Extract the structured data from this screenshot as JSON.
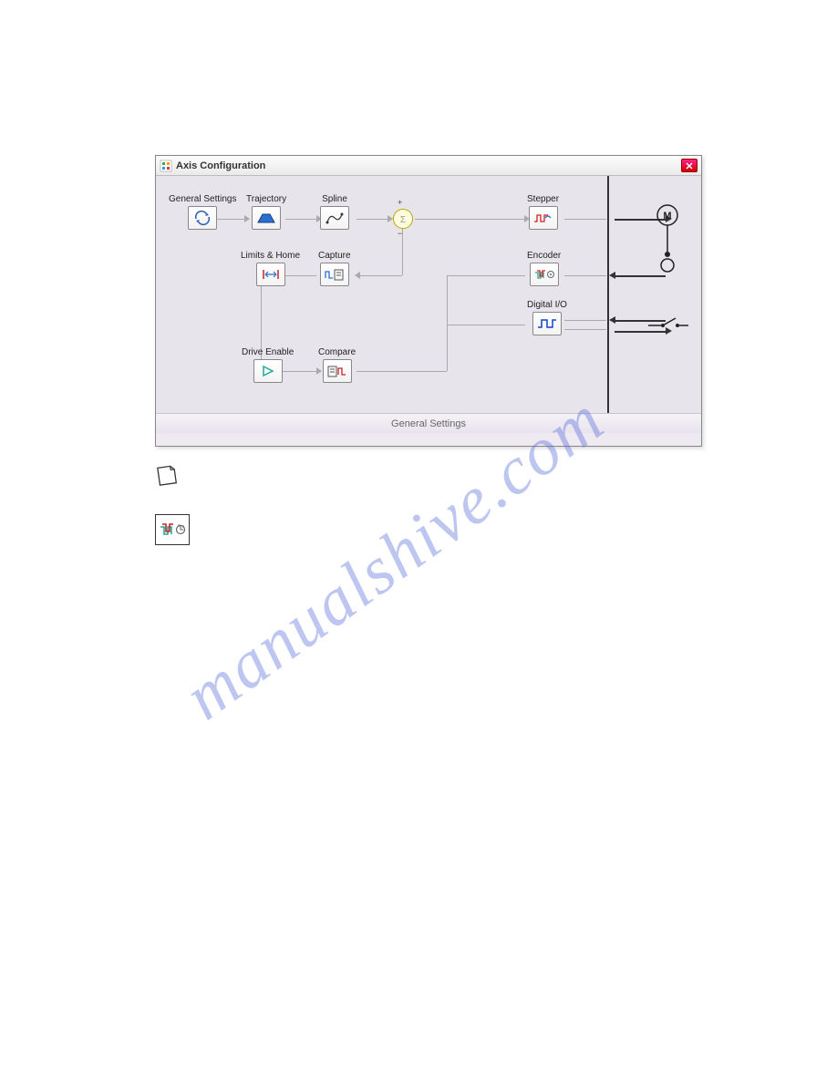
{
  "window": {
    "title": "Axis Configuration",
    "footer": "General Settings"
  },
  "blocks": {
    "general": "General Settings",
    "trajectory": "Trajectory",
    "spline": "Spline",
    "stepper": "Stepper",
    "limits": "Limits & Home",
    "capture": "Capture",
    "encoder": "Encoder",
    "digitalio": "Digital I/O",
    "drive": "Drive Enable",
    "compare": "Compare"
  },
  "watermark": "manualshive.com"
}
